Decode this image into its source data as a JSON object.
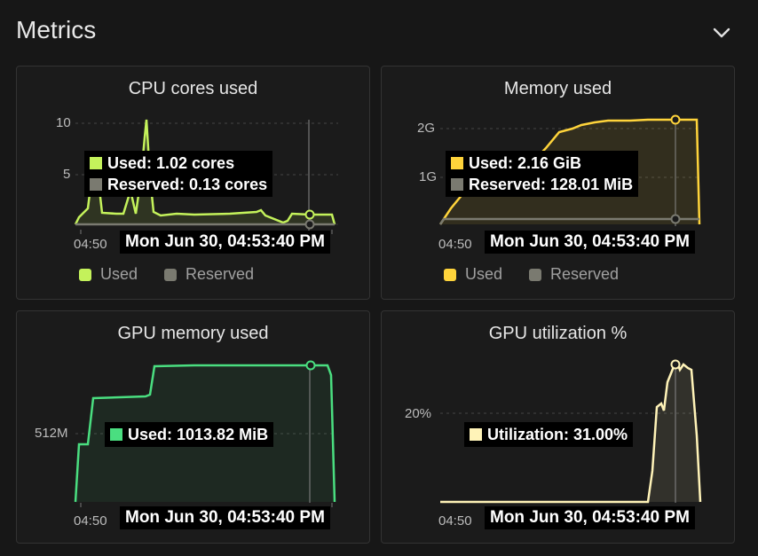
{
  "section": {
    "title": "Metrics"
  },
  "icons": {
    "collapse": "chevron-down-icon"
  },
  "colors": {
    "cpu_used": "#c4f25b",
    "reserved": "#7a7a70",
    "memory_used": "#ffd43b",
    "gpu_memory_used": "#4ade80",
    "gpu_util": "#fff3b8"
  },
  "cards": {
    "cpu": {
      "title": "CPU cores used",
      "y_ticks": [
        "10",
        "5"
      ],
      "x_tick": "04:50",
      "timestamp": "Mon Jun 30, 04:53:40 PM",
      "tooltip": {
        "used": "Used: 1.02 cores",
        "reserved": "Reserved: 0.13 cores"
      },
      "legend": [
        "Used",
        "Reserved"
      ]
    },
    "memory": {
      "title": "Memory used",
      "y_ticks": [
        "2G",
        "1G"
      ],
      "x_tick": "04:50",
      "timestamp": "Mon Jun 30, 04:53:40 PM",
      "tooltip": {
        "used": "Used: 2.16 GiB",
        "reserved": "Reserved: 128.01 MiB"
      },
      "legend": [
        "Used",
        "Reserved"
      ]
    },
    "gpu_memory": {
      "title": "GPU memory used",
      "y_ticks": [
        "512M"
      ],
      "x_tick": "04:50",
      "timestamp": "Mon Jun 30, 04:53:40 PM",
      "tooltip": {
        "used": "Used: 1013.82 MiB"
      }
    },
    "gpu_util": {
      "title": "GPU utilization %",
      "y_ticks": [
        "20%"
      ],
      "x_tick": "04:50",
      "timestamp": "Mon Jun 30, 04:53:40 PM",
      "tooltip": {
        "used": "Utilization: 31.00%"
      }
    }
  }
}
